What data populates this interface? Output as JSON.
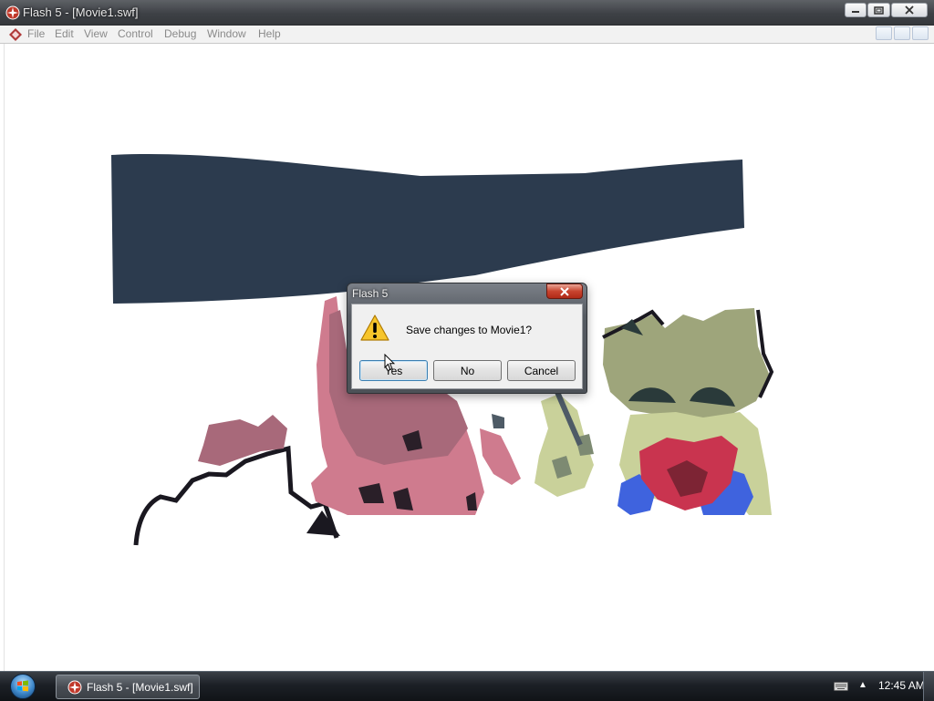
{
  "window": {
    "title": "Flash 5 - [Movie1.swf]",
    "icon": "flash-player-icon"
  },
  "menu": {
    "items": [
      "File",
      "Edit",
      "View",
      "Control",
      "Debug",
      "Window",
      "Help"
    ]
  },
  "dialog": {
    "title": "Flash 5",
    "message": "Save changes to Movie1?",
    "icon": "warning-icon",
    "buttons": {
      "yes": "Yes",
      "no": "No",
      "cancel": "Cancel"
    }
  },
  "taskbar": {
    "task_label": "Flash 5 - [Movie1.swf]",
    "clock": "12:45 AM"
  },
  "colors": {
    "banner": "#2c3b4e",
    "pink_character": "#cf7b8e",
    "mauve": "#a8697a",
    "olive_character": "#9ea57b",
    "pale_green": "#c9d19a",
    "blue": "#3f63de",
    "red": "#c9344f",
    "outline": "#1a1820",
    "dialog_close": "#c8442f"
  }
}
